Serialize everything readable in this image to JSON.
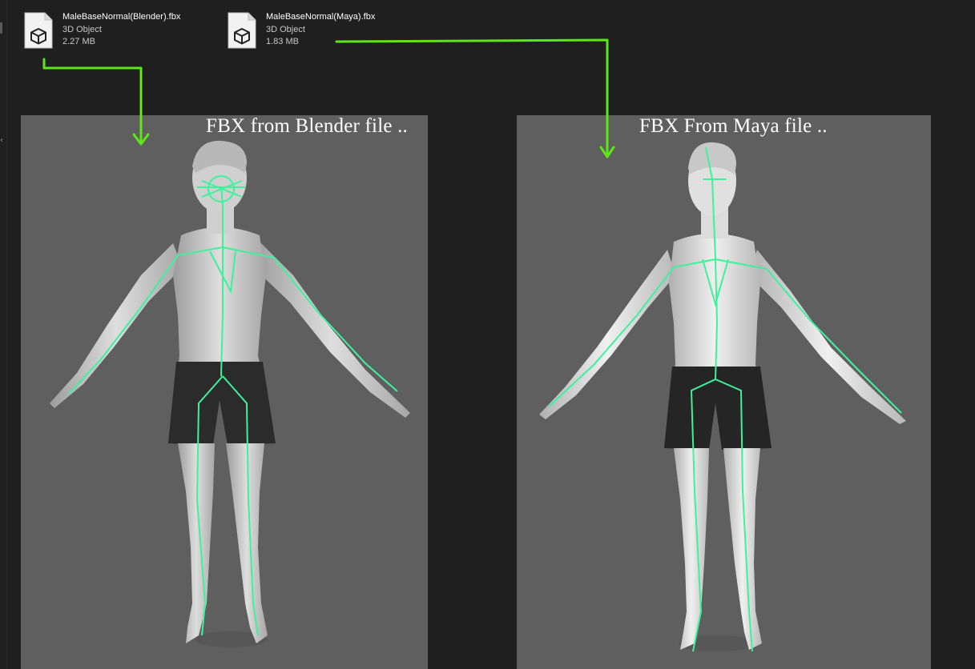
{
  "files": [
    {
      "name": "MaleBaseNormal(Blender).fbx",
      "type": "3D Object",
      "size": "2.27 MB",
      "icon": "3d-object-file-icon"
    },
    {
      "name": "MaleBaseNormal(Maya).fbx",
      "type": "3D Object",
      "size": "1.83 MB",
      "icon": "3d-object-file-icon"
    }
  ],
  "viewports": {
    "left": {
      "title": "FBX from Blender file .."
    },
    "right": {
      "title": "FBX From Maya file .."
    }
  },
  "colors": {
    "background": "#1f1f1f",
    "viewport_bg": "#5f5f5f",
    "arrow": "#5ee61a",
    "skeleton": "#3ef29a",
    "skin": "#d9d9d9",
    "shorts": "#2b2b2b"
  }
}
